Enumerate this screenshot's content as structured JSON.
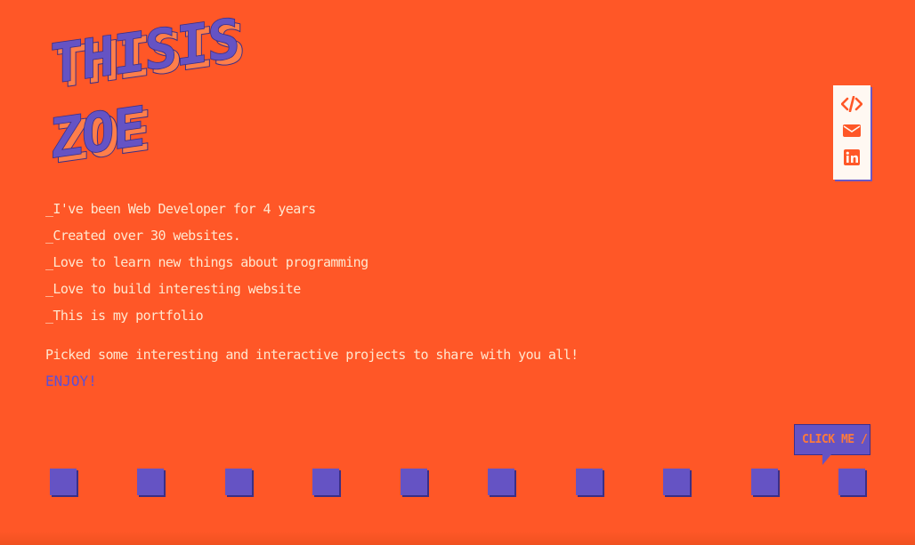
{
  "title": {
    "line1": "THISIS",
    "line2": "ZOE"
  },
  "bio": [
    "_I've been Web Developer for 4 years",
    "_Created over 30 websites.",
    "_Love to learn new things about programming",
    "_Love to build interesting website",
    "_This is my portfolio"
  ],
  "intro": "Picked some interesting and interactive projects to share with you all!",
  "enjoy": "ENJOY!",
  "tooltip": "CLICK ME /",
  "social": [
    {
      "name": "code-icon"
    },
    {
      "name": "mail-icon"
    },
    {
      "name": "linkedin-icon"
    }
  ],
  "project_squares_count": 10,
  "colors": {
    "background": "#ff5727",
    "accent": "#6553c4",
    "text": "#ffe7cf",
    "social_bg": "#fff8f2"
  }
}
